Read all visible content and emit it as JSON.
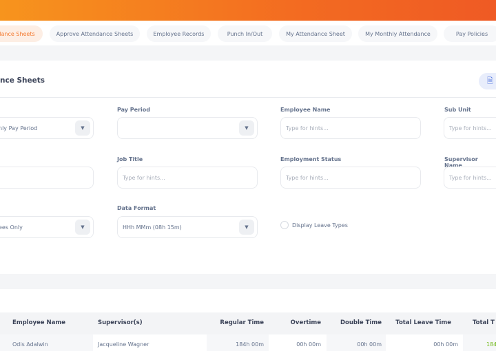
{
  "nav": {
    "tabs": [
      {
        "label": "ndance Sheets",
        "active": true
      },
      {
        "label": "Approve Attendance Sheets"
      },
      {
        "label": "Employee Records"
      },
      {
        "label": "Punch In/Out"
      },
      {
        "label": "My Attendance Sheet"
      },
      {
        "label": "My Monthly Attendance"
      },
      {
        "label": "Pay Policies"
      }
    ]
  },
  "page": {
    "title": "nce Sheets",
    "pdf_icon": "pdf-file-icon"
  },
  "filters": {
    "period_type": {
      "value": "nly Pay Period"
    },
    "pay_period": {
      "label": "Pay Period",
      "value": ""
    },
    "employee_name": {
      "label": "Employee Name",
      "placeholder": "Type for hints..."
    },
    "sub_unit": {
      "label": "Sub Unit",
      "placeholder": "Type for hints..."
    },
    "job_title": {
      "label": "Job Title",
      "placeholder": "Type for hints..."
    },
    "employment_status": {
      "label": "Employment Status",
      "placeholder": "Type for hints..."
    },
    "supervisor_name": {
      "label": "Supervisor Name",
      "placeholder": "Type for hints..."
    },
    "include": {
      "value": "ees Only"
    },
    "data_format": {
      "label": "Data Format",
      "value": "HHh MMm (08h 15m)"
    },
    "display_leave_types": {
      "label": "Display Leave Types",
      "checked": false
    }
  },
  "table": {
    "headers": [
      "Employee Name",
      "Supervisor(s)",
      "Regular Time",
      "Overtime",
      "Double Time",
      "Total Leave Time",
      "Total T"
    ],
    "rows": [
      [
        "Odis Adalwin",
        "Jacqueline Wagner",
        "184h 00m",
        "00h 00m",
        "00h 00m",
        "00h 00m",
        "184"
      ]
    ],
    "total_color": "#76bc21"
  },
  "colors": {
    "brand": "#f36b21"
  }
}
